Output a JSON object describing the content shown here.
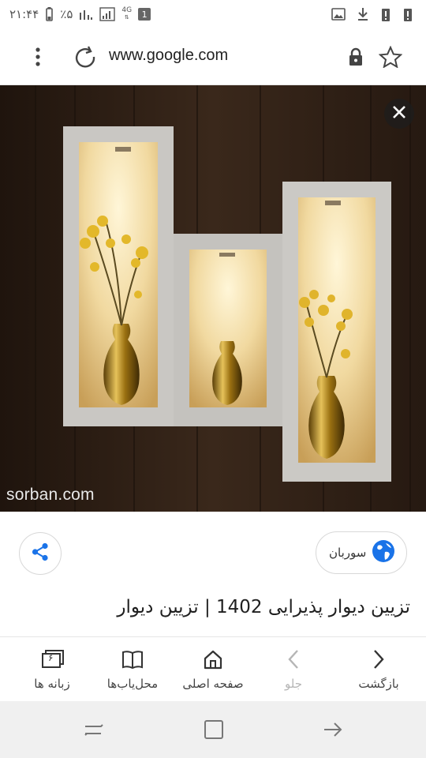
{
  "status_bar": {
    "time": "۲۱:۴۴",
    "battery": "٪۵",
    "network": "4G",
    "sim_badge": "1"
  },
  "address_bar": {
    "url": "www.google.com",
    "menu_icon": "overflow-menu-icon",
    "reload_icon": "reload-icon",
    "lock_icon": "lock-icon",
    "bookmark_icon": "star-icon"
  },
  "image_viewer": {
    "watermark": "sorban.com",
    "close_icon": "close-icon"
  },
  "result": {
    "source_name": "سوربان",
    "title": "تزیین دیوار پذیرایی 1402 | تزیین دیوار"
  },
  "bottom_nav": [
    {
      "label": "بازگشت",
      "icon": "back-icon",
      "enabled": true
    },
    {
      "label": "جلو",
      "icon": "forward-icon",
      "enabled": false
    },
    {
      "label": "صفحه اصلی",
      "icon": "home-icon",
      "enabled": true
    },
    {
      "label": "محل‌یاب‌ها",
      "icon": "bookmarks-icon",
      "enabled": true
    },
    {
      "label": "زبانه ها",
      "icon": "tabs-icon",
      "enabled": true,
      "count": "۶"
    }
  ],
  "colors": {
    "accent_blue": "#1a73e8",
    "wall_brown": "#2a1d14",
    "niche_frame": "#c9c7c3",
    "niche_glow": "#f6e2b0",
    "gold": "#b98a1c"
  }
}
